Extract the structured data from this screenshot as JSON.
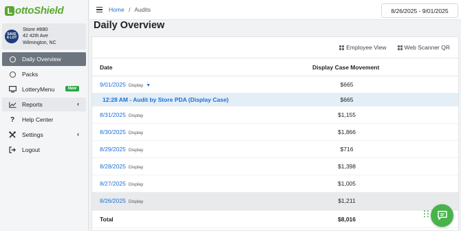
{
  "app": {
    "logo_text": "ottoShield",
    "logo_letter": "L"
  },
  "store": {
    "logo_line1": "SAVE",
    "logo_line2": "A LOT",
    "name": "Store #880",
    "address1": "42 42th Ave",
    "address2": "Wilmington, NC"
  },
  "sidebar": {
    "items": [
      {
        "label": "Daily Overview",
        "icon": "circle-icon",
        "active": true
      },
      {
        "label": "Packs",
        "icon": "circle-icon"
      },
      {
        "label": "LotteryMenu",
        "icon": "monitor-icon",
        "badge": "New"
      },
      {
        "label": "Reports",
        "icon": "chart-icon",
        "expandable": true
      },
      {
        "label": "Help Center",
        "icon": "question-icon"
      },
      {
        "label": "Settings",
        "icon": "tools-icon",
        "expandable": true
      },
      {
        "label": "Logout",
        "icon": "logout-icon"
      }
    ]
  },
  "breadcrumb": {
    "home": "Home",
    "separator": "/",
    "current": "Audits"
  },
  "date_range": "8/26/2025 - 9/01/2025",
  "page_title": "Daily Overview",
  "tools": {
    "employee_view": "Employee View",
    "web_scanner": "Web Scanner QR"
  },
  "table": {
    "headers": {
      "date": "Date",
      "movement": "Display Case Movement"
    },
    "display_label": "Display",
    "rows": [
      {
        "date": "9/01/2025",
        "value": "$665",
        "expanded": true
      },
      {
        "sub": "12:28 AM - Audit by Store PDA (Display Case)",
        "value": "$665"
      },
      {
        "date": "8/31/2025",
        "value": "$1,155"
      },
      {
        "date": "8/30/2025",
        "value": "$1,866"
      },
      {
        "date": "8/29/2025",
        "value": "$716"
      },
      {
        "date": "8/28/2025",
        "value": "$1,398"
      },
      {
        "date": "8/27/2025",
        "value": "$1,005"
      },
      {
        "date": "8/26/2025",
        "value": "$1,211"
      }
    ],
    "total_label": "Total",
    "total_value": "$8,016"
  },
  "colors": {
    "brand": "#5aa832",
    "link": "#1c6fd6",
    "active_nav": "#6c757d",
    "badge": "#28a745"
  }
}
